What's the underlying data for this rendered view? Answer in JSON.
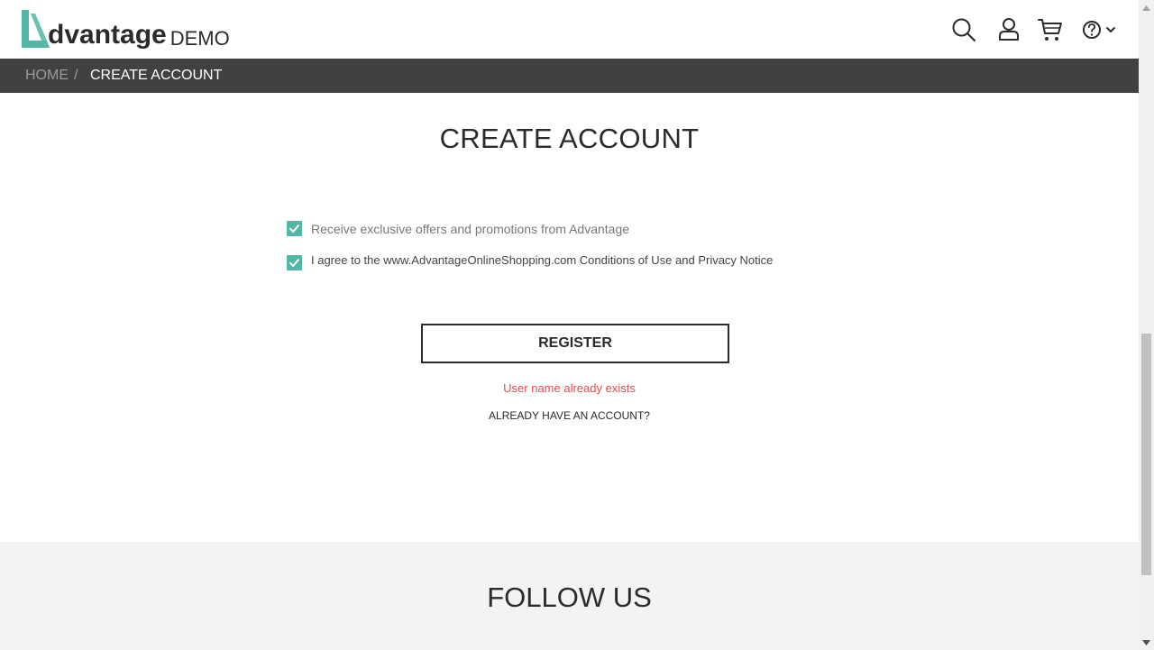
{
  "logo": {
    "word": "dvantage",
    "suffix": "DEMO",
    "accent_color": "#54b6a5"
  },
  "header": {
    "icons": [
      "search-icon",
      "user-icon",
      "cart-icon",
      "help-icon",
      "chevron-down-icon"
    ]
  },
  "breadcrumb": {
    "home": "HOME",
    "separator": "/",
    "current": "CREATE ACCOUNT"
  },
  "main": {
    "title": "CREATE ACCOUNT",
    "offers_checkbox": {
      "label": "Receive exclusive offers and promotions from Advantage",
      "checked": true
    },
    "agree_checkbox": {
      "prefix": "I agree to the ",
      "site": "www.AdvantageOnlineShopping.com",
      "terms_link": " Conditions of Use",
      "and": " and ",
      "privacy_link": "Privacy Notice",
      "checked": true
    },
    "register_label": "REGISTER",
    "error_message": "User name already exists",
    "already_have_account": "ALREADY HAVE AN ACCOUNT?"
  },
  "footer": {
    "follow_title": "FOLLOW US"
  },
  "colors": {
    "checkbox": "#54b6a5",
    "error": "#e24c4c",
    "crumb_bar": "#414141",
    "footer_bg": "#f3f3f1"
  }
}
